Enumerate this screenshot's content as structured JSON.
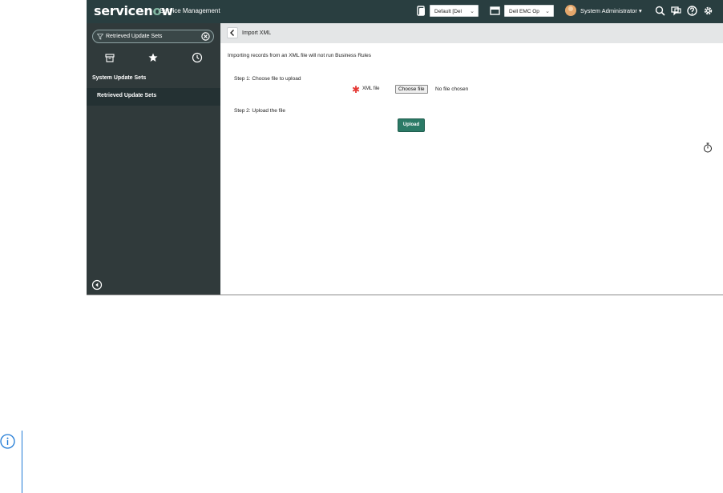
{
  "topbar": {
    "logo_main": "servicen",
    "logo_o": "o",
    "logo_end": "w",
    "app_name": "Service Management",
    "update_set_select": "Default [Del",
    "domain_select": "Dell EMC Op",
    "user_name": "System Administrator",
    "user_caret": "▾",
    "icons": [
      "update-set-icon",
      "domain-icon",
      "search-icon",
      "chat-icon",
      "help-icon",
      "gear-icon"
    ]
  },
  "sidebar": {
    "filter_value": "Retrieved Update Sets",
    "tabs": [
      "all-apps-icon",
      "favorites-star-icon",
      "history-clock-icon"
    ],
    "section_title": "System Update Sets",
    "active_item": "Retrieved Update Sets"
  },
  "main": {
    "header_title": "Import XML",
    "note": "Importing records from an XML file will not run Business Rules",
    "step1": "Step 1: Choose file to upload",
    "required_mark": "✱",
    "file_label": "XML file",
    "choose_button": "Choose file",
    "no_file_text": "No file chosen",
    "step2": "Step 2: Upload the file",
    "upload_button": "Upload"
  },
  "colors": {
    "topbar": "#293e40",
    "sidebar": "#303a3b",
    "active_item": "#243133",
    "upload_button": "#2b7a66",
    "required": "#e53935",
    "callout_blue": "#1f7ad6"
  }
}
